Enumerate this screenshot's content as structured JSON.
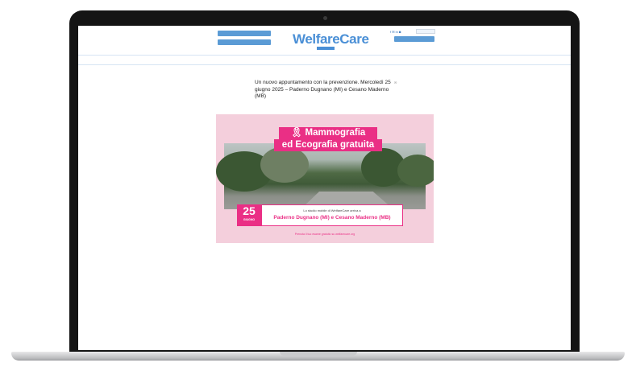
{
  "header": {
    "button_1": "",
    "button_2": "",
    "button_3": "",
    "tagline": "",
    "logo": "WelfareCare",
    "logo_badge": "",
    "social": "f ✉ in ◙",
    "search_placeholder": ""
  },
  "nav": {
    "items": [
      "",
      "",
      "",
      "",
      "",
      "",
      ""
    ]
  },
  "breadcrumb": "",
  "article": {
    "title": "Un nuovo appuntamento con la prevenzione. Mercoledì 25 giugno 2025 – Paderno Dugnano (MI) e Cesano Maderno (MB)",
    "date": "",
    "author": "",
    "comment_icon": "✉"
  },
  "hero": {
    "title_line_1": "🎗 Mammografia",
    "title_line_2": "ed Ecografia gratuita",
    "day": "25",
    "month": "GIUGNO",
    "locations_intro": "Lo studio mobile di WelfareCare arriva a",
    "locations": "Paderno Dugnano (MI) e Cesano Maderno (MB)",
    "link": "Prenota il tuo esame gratuito su welfarecare.org"
  },
  "body": {
    "p1": "",
    "p2": "",
    "p3": "",
    "p4": "",
    "p5": "",
    "p6": "",
    "p7": ""
  },
  "colors": {
    "brand_blue": "#4a8fd6",
    "accent_pink": "#ea2f85",
    "hero_bg": "#f4cfdc"
  }
}
